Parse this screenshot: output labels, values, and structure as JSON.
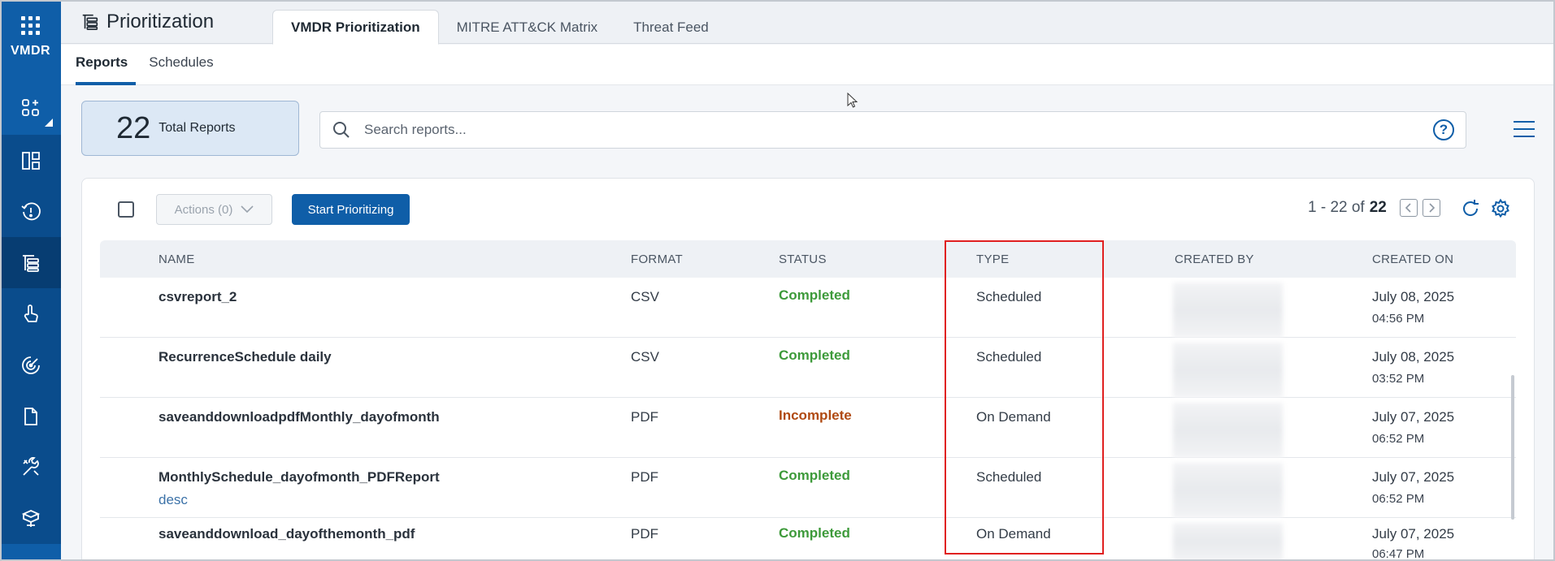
{
  "rail": {
    "label": "VMDR",
    "items": [
      "apps-add-icon",
      "dashboard-icon",
      "prioritize-clock-icon",
      "prioritization-icon",
      "hand-pointer-icon",
      "radar-icon",
      "document-icon",
      "tools-icon",
      "box-icon"
    ]
  },
  "header": {
    "title": "Prioritization",
    "tabs": [
      {
        "label": "VMDR Prioritization"
      },
      {
        "label": "MITRE ATT&CK Matrix"
      },
      {
        "label": "Threat Feed"
      }
    ]
  },
  "subtabs": [
    {
      "label": "Reports"
    },
    {
      "label": "Schedules"
    }
  ],
  "summary": {
    "count": "22",
    "label": "Total Reports"
  },
  "search": {
    "placeholder": "Search reports..."
  },
  "toolbar": {
    "actions_label": "Actions (0)",
    "start_label": "Start Prioritizing",
    "pager_range": "1 - 22 of",
    "pager_total": "22"
  },
  "table": {
    "columns": [
      "NAME",
      "FORMAT",
      "STATUS",
      "TYPE",
      "CREATED BY",
      "CREATED ON"
    ],
    "rows": [
      {
        "name": "csvreport_2",
        "desc": "",
        "format": "CSV",
        "status": "Completed",
        "type": "Scheduled",
        "date": "July 08, 2025",
        "time": "04:56 PM"
      },
      {
        "name": "RecurrenceSchedule daily",
        "desc": "",
        "format": "CSV",
        "status": "Completed",
        "type": "Scheduled",
        "date": "July 08, 2025",
        "time": "03:52 PM"
      },
      {
        "name": "saveanddownloadpdfMonthly_dayofmonth",
        "desc": "",
        "format": "PDF",
        "status": "Incomplete",
        "type": "On Demand",
        "date": "July 07, 2025",
        "time": "06:52 PM"
      },
      {
        "name": "MonthlySchedule_dayofmonth_PDFReport",
        "desc": "desc",
        "format": "PDF",
        "status": "Completed",
        "type": "Scheduled",
        "date": "July 07, 2025",
        "time": "06:52 PM"
      },
      {
        "name": "saveanddownload_dayofthemonth_pdf",
        "desc": "",
        "format": "PDF",
        "status": "Completed",
        "type": "On Demand",
        "date": "July 07, 2025",
        "time": "06:47 PM"
      }
    ]
  },
  "colors": {
    "brand": "#0f5ea8",
    "completed": "#3d9a3a",
    "incomplete": "#b04a12",
    "highlight": "#e02020"
  }
}
